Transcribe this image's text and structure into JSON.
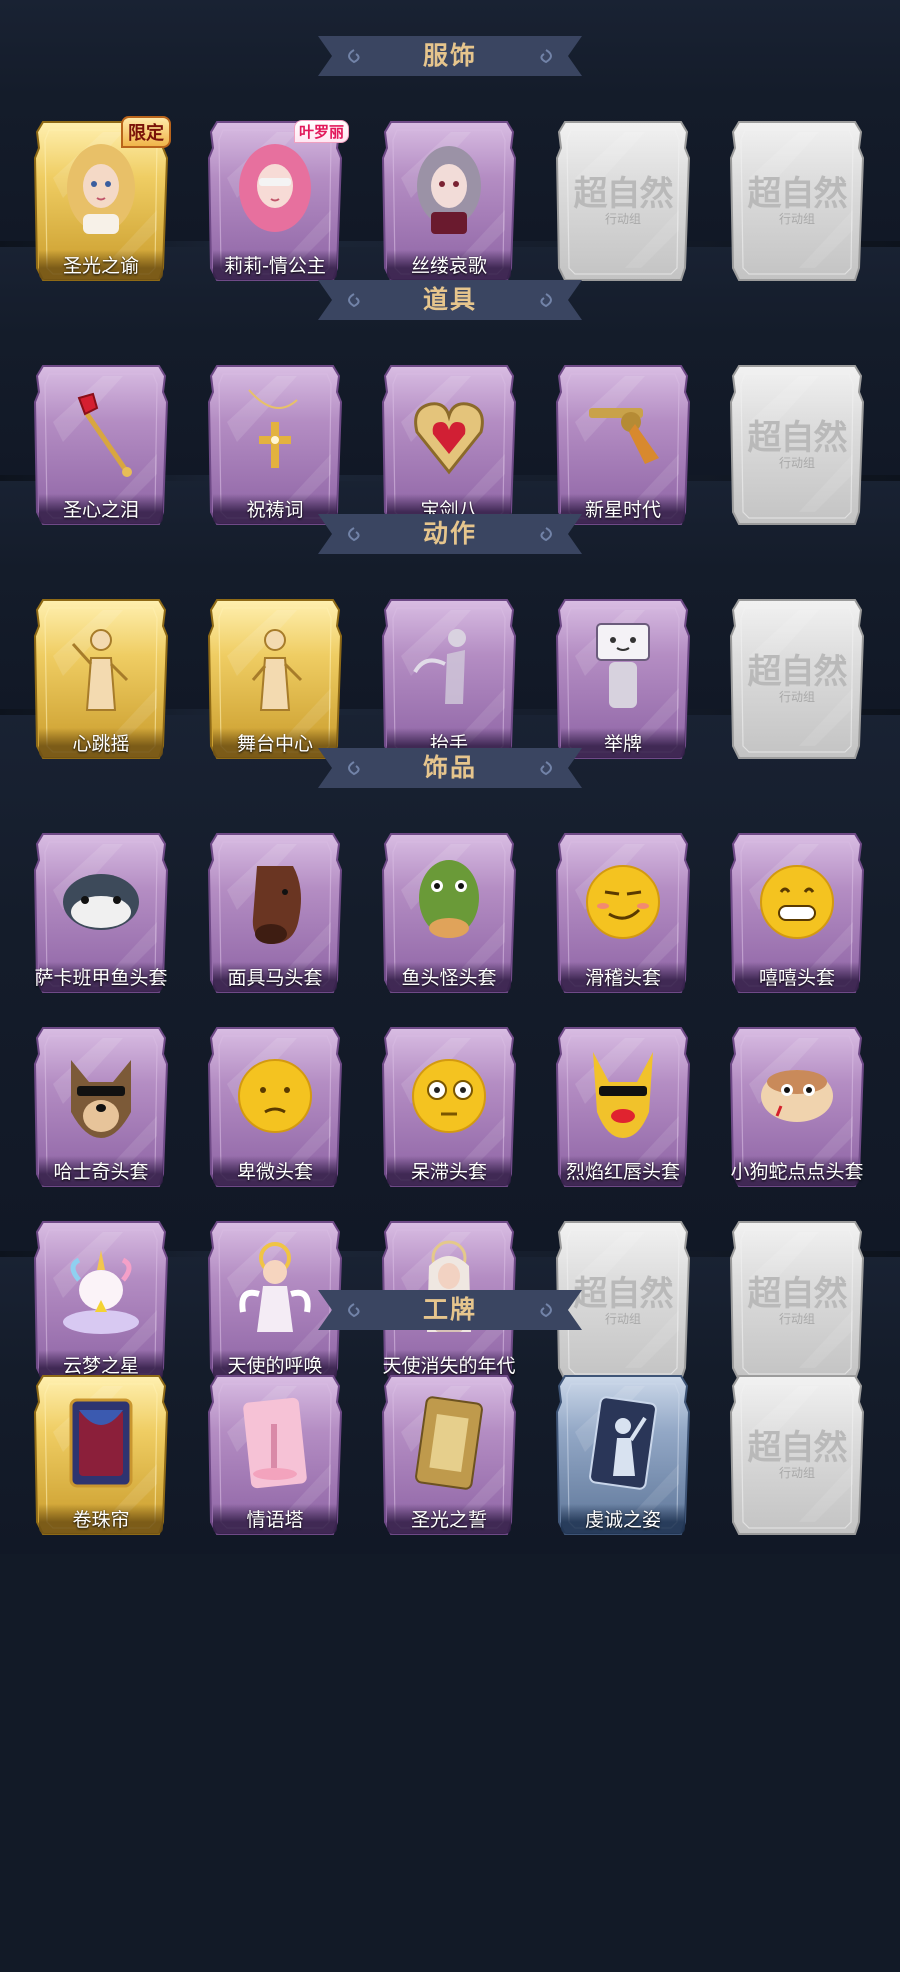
{
  "placeholder": {
    "text": "超自然",
    "subtext": "行动组"
  },
  "sections": [
    {
      "title": "服饰",
      "items": [
        {
          "label": "圣光之谕",
          "variant": "gold",
          "tag": "限定",
          "icon": "blonde-portrait-icon"
        },
        {
          "label": "莉莉-情公主",
          "variant": "purple",
          "tag": "叶罗丽",
          "icon": "pink-hair-portrait-icon"
        },
        {
          "label": "丝缕哀歌",
          "variant": "purple",
          "icon": "gothic-portrait-icon"
        },
        {
          "label": "",
          "variant": "empty"
        },
        {
          "label": "",
          "variant": "empty"
        }
      ]
    },
    {
      "title": "道具",
      "items": [
        {
          "label": "圣心之泪",
          "variant": "purple",
          "icon": "ruby-scepter-icon"
        },
        {
          "label": "祝祷词",
          "variant": "purple",
          "icon": "cross-pendant-icon"
        },
        {
          "label": "宝剑八",
          "variant": "purple",
          "icon": "heart-mirror-icon"
        },
        {
          "label": "新星时代",
          "variant": "purple",
          "icon": "revolver-icon"
        },
        {
          "label": "",
          "variant": "empty"
        }
      ]
    },
    {
      "title": "动作",
      "items": [
        {
          "label": "心跳摇",
          "variant": "gold",
          "icon": "dance-pose-icon"
        },
        {
          "label": "舞台中心",
          "variant": "gold",
          "icon": "stage-pose-icon"
        },
        {
          "label": "抬手",
          "variant": "purple",
          "icon": "raise-hand-icon"
        },
        {
          "label": "举牌",
          "variant": "purple",
          "icon": "hold-sign-icon"
        },
        {
          "label": "",
          "variant": "empty"
        }
      ]
    },
    {
      "title": "饰品",
      "items": [
        {
          "label": "萨卡班甲鱼头套",
          "variant": "purple",
          "icon": "fish-head-icon"
        },
        {
          "label": "面具马头套",
          "variant": "purple",
          "icon": "horse-head-icon"
        },
        {
          "label": "鱼头怪头套",
          "variant": "purple",
          "icon": "fishman-head-icon"
        },
        {
          "label": "滑稽头套",
          "variant": "purple",
          "icon": "smirk-emoji-icon"
        },
        {
          "label": "嘻嘻头套",
          "variant": "purple",
          "icon": "grin-emoji-icon"
        },
        {
          "label": "哈士奇头套",
          "variant": "purple",
          "icon": "husky-head-icon"
        },
        {
          "label": "卑微头套",
          "variant": "purple",
          "icon": "humble-emoji-icon"
        },
        {
          "label": "呆滞头套",
          "variant": "purple",
          "icon": "stare-emoji-icon"
        },
        {
          "label": "烈焰红唇头套",
          "variant": "purple",
          "icon": "red-lips-head-icon"
        },
        {
          "label": "小狗蛇点点头套",
          "variant": "purple",
          "icon": "snake-head-icon"
        },
        {
          "label": "云梦之星",
          "variant": "purple",
          "icon": "unicorn-cloud-icon"
        },
        {
          "label": "天使的呼唤",
          "variant": "purple",
          "icon": "angel-figure-icon"
        },
        {
          "label": "天使消失的年代",
          "variant": "purple",
          "icon": "veiled-figure-icon"
        },
        {
          "label": "",
          "variant": "empty"
        },
        {
          "label": "",
          "variant": "empty"
        }
      ]
    },
    {
      "title": "工牌",
      "items": [
        {
          "label": "卷珠帘",
          "variant": "gold",
          "icon": "curtain-card-icon"
        },
        {
          "label": "情语塔",
          "variant": "purple",
          "icon": "pink-tower-card-icon"
        },
        {
          "label": "圣光之誓",
          "variant": "purple",
          "icon": "golden-gate-card-icon"
        },
        {
          "label": "虔诚之姿",
          "variant": "blue",
          "icon": "silhouette-card-icon"
        },
        {
          "label": "",
          "variant": "empty"
        }
      ]
    }
  ],
  "colors": {
    "background": "#121a27",
    "banner": "#3a4561",
    "title": "#e6c58d",
    "purple_card": "#9c72ad",
    "gold_card": "#d9b24a",
    "blue_card": "#6e86a8",
    "empty_card": "#c9c9c9"
  }
}
